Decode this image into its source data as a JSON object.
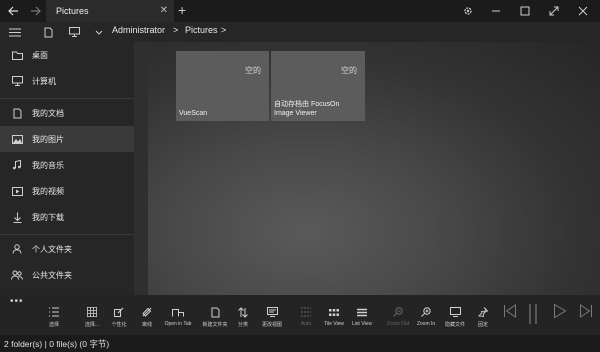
{
  "titlebar": {
    "tab_title": "Pictures",
    "tab_close": "✕",
    "new_tab": "+"
  },
  "address": {
    "crumbs": [
      "Administrator",
      ">",
      "Pictures",
      ">"
    ]
  },
  "sidebar": {
    "items": [
      {
        "label": "桌面",
        "icon": "folder-icon"
      },
      {
        "label": "计算机",
        "icon": "monitor-icon"
      },
      {
        "label": "我的文档",
        "icon": "document-icon"
      },
      {
        "label": "我的图片",
        "icon": "picture-icon"
      },
      {
        "label": "我的音乐",
        "icon": "music-icon"
      },
      {
        "label": "我的视频",
        "icon": "video-icon"
      },
      {
        "label": "我的下载",
        "icon": "download-icon"
      },
      {
        "label": "个人文件夹",
        "icon": "person-icon"
      },
      {
        "label": "公共文件夹",
        "icon": "people-icon"
      }
    ]
  },
  "main": {
    "tiles": [
      {
        "name": "VueScan",
        "badge": "空的"
      },
      {
        "name": "自动存档由 FocusOn Image Viewer",
        "badge": "空的"
      }
    ]
  },
  "toolbar": {
    "more": "•••",
    "tools": [
      {
        "label": "选择",
        "icon": "select-icon"
      },
      {
        "label": "选择...",
        "icon": "select-grid-icon"
      },
      {
        "label": "个性化",
        "icon": "personalize-icon"
      },
      {
        "label": "离线",
        "icon": "offline-icon"
      },
      {
        "label": "Open in Tab",
        "icon": "open-tab-icon"
      },
      {
        "label": "新建文件夹",
        "icon": "new-folder-icon"
      },
      {
        "label": "分类",
        "icon": "sort-icon"
      },
      {
        "label": "更改视图",
        "icon": "change-view-icon"
      },
      {
        "label": "Auto",
        "icon": "auto-icon",
        "disabled": true
      },
      {
        "label": "Tile View",
        "icon": "tile-view-icon"
      },
      {
        "label": "List View",
        "icon": "list-view-icon"
      },
      {
        "label": "Zoom Out",
        "icon": "zoom-out-icon",
        "disabled": true
      },
      {
        "label": "Zoom In",
        "icon": "zoom-in-icon"
      },
      {
        "label": "隐藏文件",
        "icon": "hidden-files-icon"
      },
      {
        "label": "固定",
        "icon": "pin-icon"
      }
    ]
  },
  "status": {
    "text": "2 folder(s)  |  0 file(s) (0 字节)"
  }
}
